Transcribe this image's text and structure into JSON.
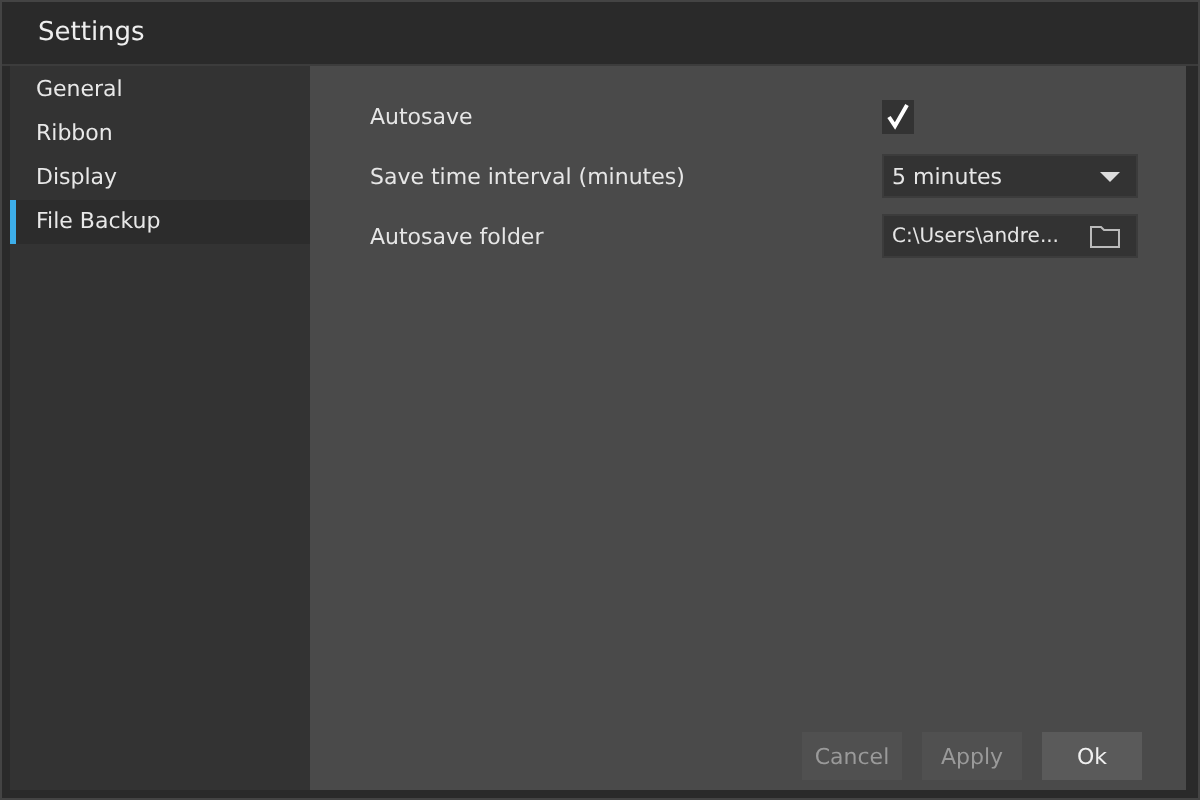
{
  "window": {
    "title": "Settings"
  },
  "sidebar": {
    "items": [
      {
        "label": "General",
        "selected": false
      },
      {
        "label": "Ribbon",
        "selected": false
      },
      {
        "label": "Display",
        "selected": false
      },
      {
        "label": "File Backup",
        "selected": true
      }
    ]
  },
  "settings": [
    {
      "kind": "checkbox",
      "label": "Autosave",
      "checked": true
    },
    {
      "kind": "dropdown",
      "label": "Save time interval (minutes)",
      "value": "5 minutes"
    },
    {
      "kind": "folder",
      "label": "Autosave folder",
      "value": "C:\\Users\\andre..."
    }
  ],
  "buttons": [
    {
      "label": "Cancel",
      "disabled": true
    },
    {
      "label": "Apply",
      "disabled": true
    },
    {
      "label": "Ok",
      "disabled": false
    }
  ]
}
